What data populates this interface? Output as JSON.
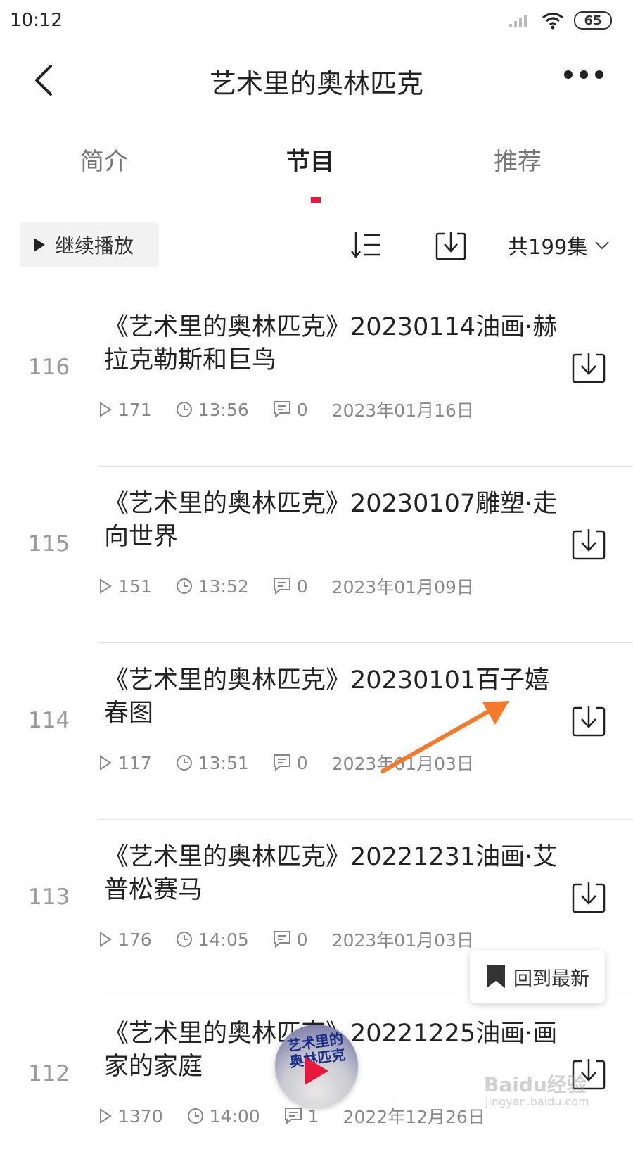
{
  "status": {
    "time": "10:12",
    "battery": "65"
  },
  "nav": {
    "title": "艺术里的奥林匹克"
  },
  "tabs": [
    {
      "label": "简介"
    },
    {
      "label": "节目"
    },
    {
      "label": "推荐"
    }
  ],
  "toolbar": {
    "continue_label": "继续播放",
    "count_label": "共199集"
  },
  "episodes": [
    {
      "num": "116",
      "title": "《艺术里的奥林匹克》20230114油画·赫拉克勒斯和巨鸟",
      "plays": "171",
      "duration": "13:56",
      "comments": "0",
      "date": "2023年01月16日"
    },
    {
      "num": "115",
      "title": "《艺术里的奥林匹克》20230107雕塑·走向世界",
      "plays": "151",
      "duration": "13:52",
      "comments": "0",
      "date": "2023年01月09日"
    },
    {
      "num": "114",
      "title": "《艺术里的奥林匹克》20230101百子嬉春图",
      "plays": "117",
      "duration": "13:51",
      "comments": "0",
      "date": "2023年01月03日"
    },
    {
      "num": "113",
      "title": "《艺术里的奥林匹克》20221231油画·艾普松赛马",
      "plays": "176",
      "duration": "14:05",
      "comments": "0",
      "date": "2023年01月03日"
    },
    {
      "num": "112",
      "title": "《艺术里的奥林匹克》20221225油画·画家的家庭",
      "plays": "1370",
      "duration": "14:00",
      "comments": "1",
      "date": "2022年12月26日"
    }
  ],
  "floating": {
    "back_latest_label": "回到最新"
  },
  "player": {
    "cover_text": "艺术里的奥林匹克"
  },
  "watermark": {
    "text": "Baidu经验",
    "sub": "jingyan.baidu.com"
  },
  "colors": {
    "accent": "#e8173b",
    "annotation_arrow": "#f47a2a"
  }
}
